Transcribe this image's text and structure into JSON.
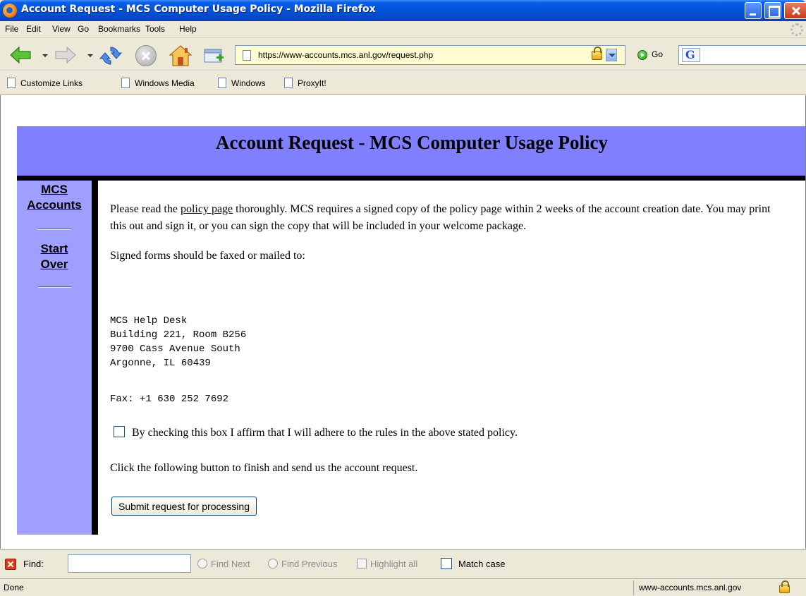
{
  "window": {
    "title": "Account Request - MCS Computer Usage Policy - Mozilla Firefox"
  },
  "menu": {
    "items": [
      "File",
      "Edit",
      "View",
      "Go",
      "Bookmarks",
      "Tools",
      "Help"
    ]
  },
  "navigation": {
    "url": "https://www-accounts.mcs.anl.gov/request.php",
    "go_label": "Go",
    "search_engine_icon": "google-icon"
  },
  "bookmarks": {
    "items": [
      "Customize Links",
      "Windows Media",
      "Windows",
      "ProxyIt!"
    ]
  },
  "page": {
    "title": "Account Request - MCS Computer Usage Policy",
    "sidebar": {
      "links": [
        "MCS",
        "Accounts",
        "Start",
        "Over"
      ]
    },
    "intro": {
      "before_link": "Please read the ",
      "link_text": "policy page",
      "after_link": " thoroughly. MCS requires a signed copy of the policy page within 2 weeks of the account creation date. You may print this out and sign it, or you can sign the copy that will be included in your welcome package."
    },
    "mail_instruction": "Signed forms should be faxed or mailed to:",
    "address": "MCS Help Desk\nBuilding 221, Room B256\n9700 Cass Avenue South\nArgonne, IL 60439",
    "fax": "Fax: +1 630 252 7692",
    "affirm_label": "By checking this box I affirm that I will adhere to the rules in the above stated policy.",
    "affirm_checked": false,
    "submit_instruction": "Click the following button to finish and send us the account request.",
    "submit_label": "Submit request for processing"
  },
  "find_bar": {
    "label": "Find:",
    "value": "",
    "find_next": "Find Next",
    "find_previous": "Find Previous",
    "highlight_all": "Highlight all",
    "match_case": "Match case",
    "match_case_checked": false
  },
  "status": {
    "text": "Done",
    "host": "www-accounts.mcs.anl.gov"
  },
  "colors": {
    "banner": "#8080ff",
    "sidebar": "#9f9fff",
    "url_bar": "#fffbd2"
  }
}
